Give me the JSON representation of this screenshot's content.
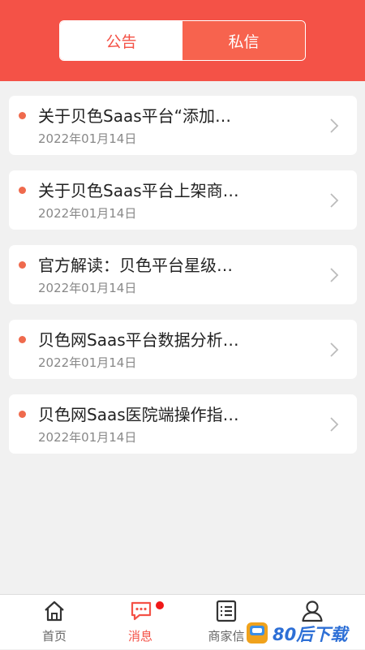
{
  "header": {
    "tabs": [
      {
        "label": "公告",
        "active": false
      },
      {
        "label": "私信",
        "active": true
      }
    ]
  },
  "messages": [
    {
      "title": "关于贝色Saas平台“添加…",
      "date": "2022年01月14日"
    },
    {
      "title": "关于贝色Saas平台上架商…",
      "date": "2022年01月14日"
    },
    {
      "title": "官方解读：贝色平台星级…",
      "date": "2022年01月14日"
    },
    {
      "title": "贝色网Saas平台数据分析…",
      "date": "2022年01月14日"
    },
    {
      "title": "贝色网Saas医院端操作指…",
      "date": "2022年01月14日"
    }
  ],
  "tabbar": {
    "items": [
      {
        "label": "首页",
        "icon": "home-icon",
        "active": false
      },
      {
        "label": "消息",
        "icon": "message-icon",
        "active": true,
        "badge": true
      },
      {
        "label": "商家信",
        "icon": "list-icon",
        "active": false
      },
      {
        "label": "",
        "icon": "user-icon",
        "active": false
      }
    ]
  },
  "watermark": {
    "text": "80后下载"
  },
  "colors": {
    "brand": "#f45247",
    "dot": "#ef6a4d",
    "badge": "#f01818"
  }
}
